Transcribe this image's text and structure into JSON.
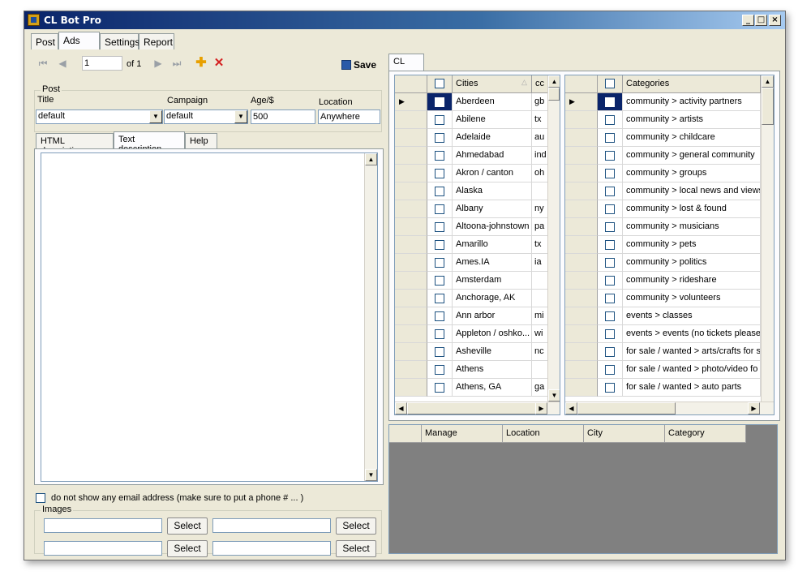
{
  "window": {
    "title": "CL Bot Pro",
    "min": "_",
    "max": "□",
    "close": "×"
  },
  "main_tabs": [
    {
      "label": "Post"
    },
    {
      "label": "Ads"
    },
    {
      "label": "Settings"
    },
    {
      "label": "Report"
    }
  ],
  "toolbar": {
    "position": "1",
    "of_label": "of 1",
    "save_label": "Save"
  },
  "post": {
    "group_label": "Post",
    "title_label": "Title",
    "campaign_label": "Campaign",
    "age_label": "Age/$",
    "location_label": "Location",
    "title_value": "default",
    "campaign_value": "default",
    "age_value": "500",
    "location_value": "Anywhere"
  },
  "desc_tabs": [
    {
      "label": "HTML description"
    },
    {
      "label": "Text description"
    },
    {
      "label": "Help"
    }
  ],
  "email_checkbox_label": "do not show any email address (make sure to put a phone # ... )",
  "images": {
    "group_label": "Images",
    "select_label": "Select"
  },
  "right_tab": {
    "label": "CL"
  },
  "cities_grid": {
    "headers": {
      "name": "Cities",
      "code": "cc"
    },
    "rows": [
      {
        "name": "Aberdeen",
        "code": "gb"
      },
      {
        "name": "Abilene",
        "code": "tx"
      },
      {
        "name": "Adelaide",
        "code": "au"
      },
      {
        "name": "Ahmedabad",
        "code": "ind"
      },
      {
        "name": "Akron / canton",
        "code": "oh"
      },
      {
        "name": "Alaska",
        "code": ""
      },
      {
        "name": "Albany",
        "code": "ny"
      },
      {
        "name": "Altoona-johnstown",
        "code": "pa"
      },
      {
        "name": "Amarillo",
        "code": "tx"
      },
      {
        "name": "Ames.IA",
        "code": "ia"
      },
      {
        "name": "Amsterdam",
        "code": ""
      },
      {
        "name": "Anchorage, AK",
        "code": ""
      },
      {
        "name": "Ann arbor",
        "code": "mi"
      },
      {
        "name": "Appleton / oshko...",
        "code": "wi"
      },
      {
        "name": "Asheville",
        "code": "nc"
      },
      {
        "name": "Athens",
        "code": ""
      },
      {
        "name": "Athens, GA",
        "code": "ga"
      }
    ]
  },
  "categories_grid": {
    "header": "Categories",
    "rows": [
      "community > activity partners",
      "community > artists",
      "community > childcare",
      "community > general community",
      "community > groups",
      "community > local news and views",
      "community > lost & found",
      "community > musicians",
      "community > pets",
      "community > politics",
      "community > rideshare",
      "community > volunteers",
      "events > classes",
      "events > events (no tickets please!",
      "for sale / wanted >  arts/crafts for s",
      "for sale / wanted >  photo/video fo",
      "for sale / wanted > auto parts"
    ]
  },
  "manage_grid": {
    "headers": [
      "Manage",
      "Location",
      "City",
      "Category"
    ]
  }
}
